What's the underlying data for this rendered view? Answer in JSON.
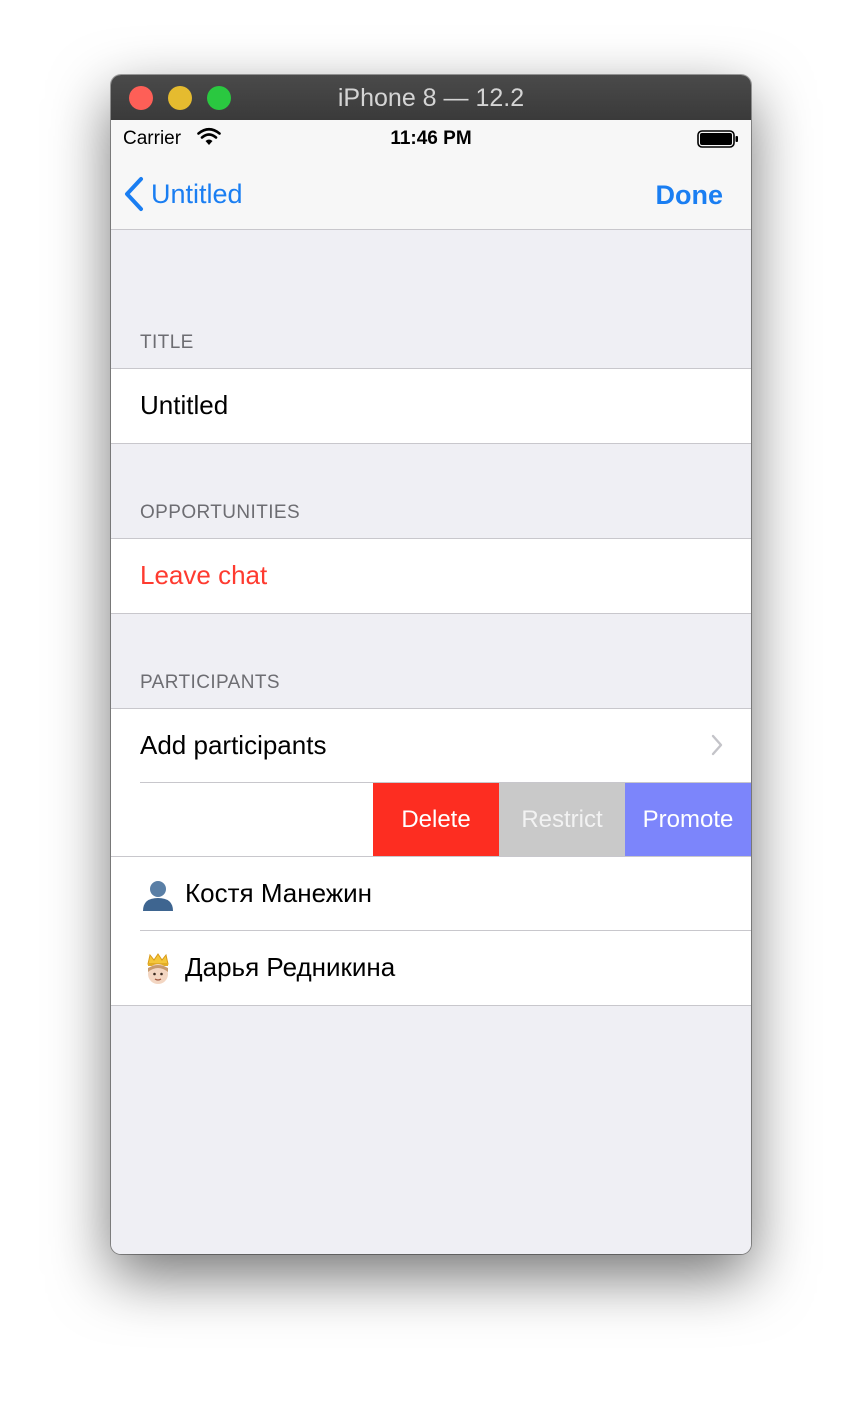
{
  "window": {
    "title": "iPhone 8 — 12.2"
  },
  "status_bar": {
    "carrier": "Carrier",
    "time": "11:46 PM"
  },
  "nav": {
    "back_label": "Untitled",
    "done_label": "Done"
  },
  "sections": {
    "title_header": "TITLE",
    "title_value": "Untitled",
    "opportunities_header": "OPPORTUNITIES",
    "leave_chat_label": "Leave chat",
    "participants_header": "PARTICIPANTS",
    "add_participants_label": "Add participants"
  },
  "swipe_actions": {
    "delete": "Delete",
    "restrict": "Restrict",
    "promote": "Promote"
  },
  "participants": [
    {
      "emoji": "bust-silhouette-icon",
      "name": "Костя Манежин"
    },
    {
      "emoji": "prince-icon",
      "name": "Дарья Редникина"
    }
  ],
  "colors": {
    "accent": "#1a7ef2",
    "destructive": "#fe3b30",
    "delete_action": "#fd2d21",
    "restrict_action": "#c9c9c9",
    "promote_action": "#7c85fb",
    "grouped_background": "#efeff4"
  }
}
